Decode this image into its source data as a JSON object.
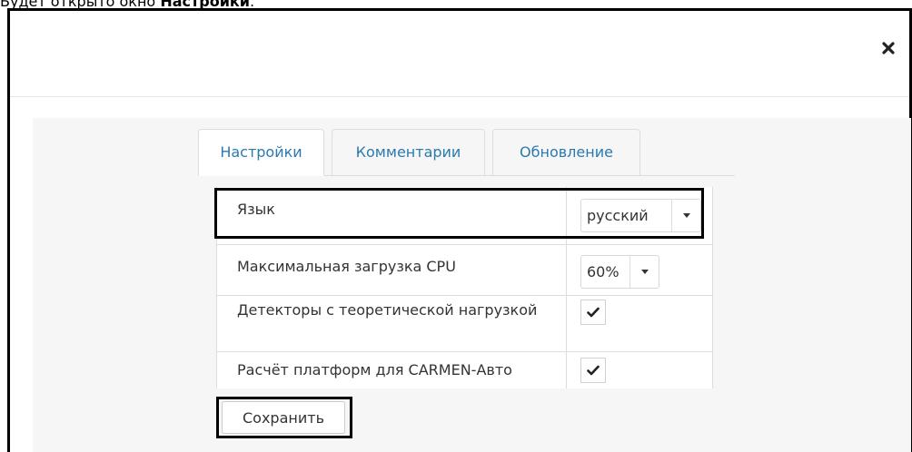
{
  "caption": {
    "prefix": "Будет открыто окно ",
    "bold": "Настройки",
    "suffix": "."
  },
  "dialog": {
    "close_icon": "close-icon"
  },
  "tabs": [
    {
      "label": "Настройки",
      "active": true
    },
    {
      "label": "Комментарии",
      "active": false
    },
    {
      "label": "Обновление",
      "active": false
    }
  ],
  "settings": {
    "language": {
      "label": "Язык",
      "value": "русский"
    },
    "cpu": {
      "label": "Максимальная загрузка CPU",
      "value": "60%"
    },
    "detectors": {
      "label": "Детекторы с теоретической нагрузкой",
      "checked": true
    },
    "carmen": {
      "label": "Расчёт платформ для CARMEN-Авто",
      "checked": true
    }
  },
  "save_label": "Сохранить",
  "colors": {
    "tab_text": "#2a7ab0",
    "body_bg": "#f6f6f6",
    "highlight": "#000000"
  }
}
